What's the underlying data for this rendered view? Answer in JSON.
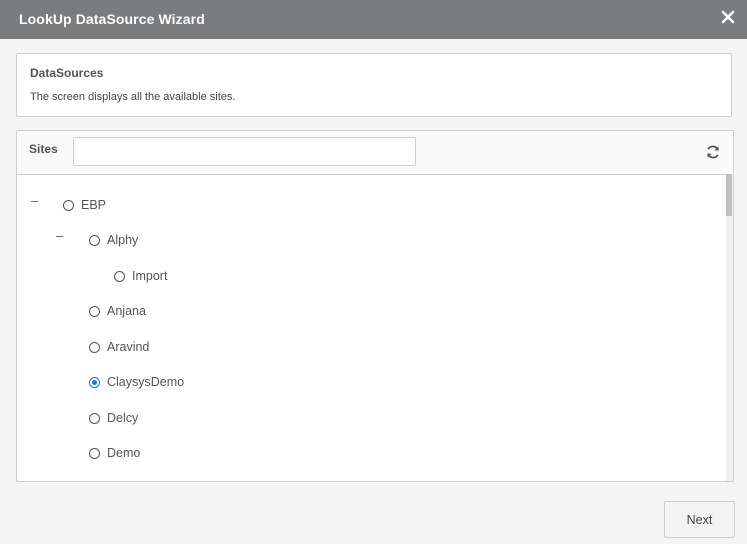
{
  "dialog": {
    "title": "LookUp DataSource Wizard"
  },
  "info": {
    "heading": "DataSources",
    "description": "The screen displays all the available sites."
  },
  "sites": {
    "label": "Sites",
    "search_value": "",
    "tree": [
      {
        "label": "EBP",
        "checked": false,
        "toggle": "–"
      },
      {
        "label": "Alphy",
        "checked": false,
        "toggle": "–"
      },
      {
        "label": "Import",
        "checked": false
      },
      {
        "label": "Anjana",
        "checked": false
      },
      {
        "label": "Aravind",
        "checked": false
      },
      {
        "label": "ClaysysDemo",
        "checked": true
      },
      {
        "label": "Delcy",
        "checked": false
      },
      {
        "label": "Demo",
        "checked": false
      }
    ]
  },
  "footer": {
    "next_label": "Next"
  },
  "icons": {
    "close": "close-icon",
    "refresh": "refresh-icon"
  },
  "colors": {
    "titlebar": "#7b7c7e",
    "selected_radio": "#1a73e8"
  }
}
